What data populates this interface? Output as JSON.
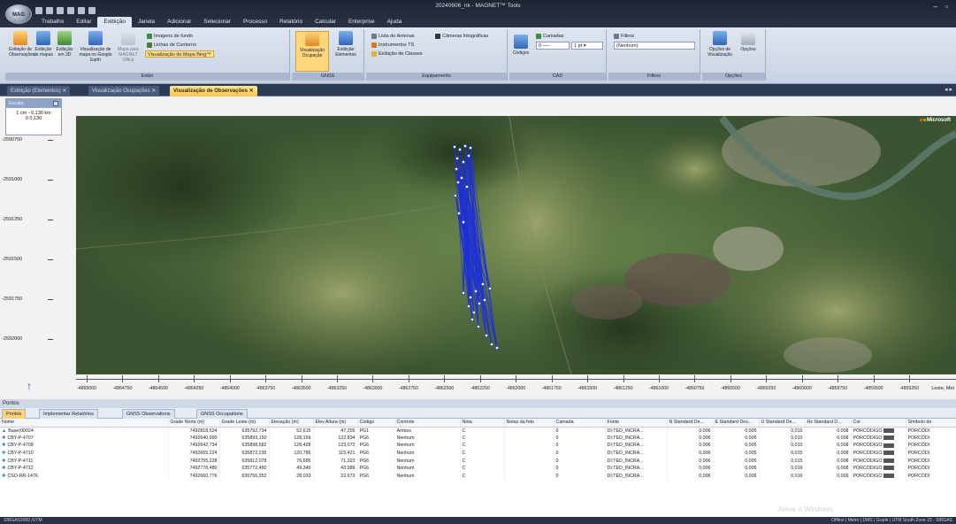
{
  "window": {
    "title": "20240606_nk - MAGNET™ Tools",
    "orb_label": "MAG"
  },
  "menu_tabs": [
    "Trabalho",
    "Editar",
    "Exibição",
    "Janela",
    "Adicionar",
    "Selecionar",
    "Processo",
    "Relatório",
    "Calcular",
    "Enterprise",
    "Ajuda"
  ],
  "active_menu_tab": "Exibição",
  "ribbon": {
    "buttons": [
      "Exibição de Observações",
      "Exibição de mapas",
      "Exibição em 3D",
      "Visualização de mapa no Google Earth",
      "Mapa para MAGNET Office"
    ],
    "small_items": [
      "Imagens de fundo",
      "Linhas de Contorno",
      "Visualização do Mapa Bing™",
      "Lista de Antenas",
      "Câmeras fotográficas",
      "Instrumentos TS",
      "Exibição de Classes"
    ],
    "gnss_buttons": [
      "Visualização Ocupação",
      "Exibição Elementos"
    ],
    "group_labels": [
      "Exibir",
      "GNSS",
      "Equipamento",
      "CAD",
      "Filtros",
      "Opções"
    ],
    "cad": {
      "camadas_label": "Camadas",
      "layer_value": "0",
      "line_value": "1 pt"
    },
    "codigos_label": "Códigos",
    "filtros": {
      "label": "Filtros",
      "value": "(Nenhum)"
    },
    "opcoes_buttons": [
      "Opções de Visualização",
      "Opções"
    ]
  },
  "doc_tabs": [
    {
      "label": "Exibição (Elementos)",
      "active": false
    },
    {
      "label": "Visualização Ocupações",
      "active": false
    },
    {
      "label": "Visualização de Observações",
      "active": true
    }
  ],
  "map": {
    "legend_title": "Escala",
    "scale_text": "1 cm - 0,130 km",
    "scale_values": "0    0,130",
    "provider_label": "Microsoft",
    "y_ticks": [
      "-2590750",
      "-2591000",
      "-2591250",
      "-2591500",
      "-2591750",
      "-2592000"
    ],
    "x_ticks": [
      "-4865000",
      "-4864750",
      "-4864500",
      "-4864250",
      "-4864000",
      "-4863750",
      "-4863500",
      "-4863250",
      "-4863000",
      "-4862750",
      "-4862500",
      "-4862250",
      "-4862000",
      "-4861750",
      "-4861500",
      "-4861250",
      "-4861000",
      "-4860750",
      "-4860500",
      "-4860250",
      "-4860000",
      "-4859750",
      "-4859500",
      "-4859250"
    ],
    "x_axis_label": "Leste, Met"
  },
  "panel": {
    "title": "Pontos",
    "tabs": [
      {
        "label": "Pontos",
        "active": true
      },
      {
        "label": "Implementar Relatórios",
        "active": false
      },
      {
        "label": "GNSS Observations",
        "active": false
      },
      {
        "label": "GNSS Occupations",
        "active": false
      }
    ],
    "columns": [
      "Nome",
      "Grade Norte (m)",
      "Grade Leste (m)",
      "Elevação (m)",
      "Elev.Altura (m)",
      "Código",
      "Controle",
      "Nota",
      "Notas da foto",
      "Camada",
      "Fonte",
      "N Standard De...",
      "E Standard Dev...",
      "U Standard De...",
      "Hz Standard D...",
      "Cor",
      "Símbolo de"
    ],
    "rows": [
      [
        "Base(00024",
        "7492818,524",
        "635792,734",
        "52,615",
        "47,255",
        "PG1",
        "Ambos",
        "C",
        "",
        "0",
        "DI;TED_INCRA...",
        "0,006",
        "0,005",
        "0,015",
        "0,008",
        "PORCÓDIGO",
        "PORCÓDI"
      ],
      [
        "CBY-P-4707",
        "7492640,990",
        "635893,150",
        "128,159",
        "122,834",
        "PG6",
        "Nenhum",
        "C",
        "",
        "0",
        "DI;TED_INCRA...",
        "0,006",
        "0,005",
        "0,015",
        "0,008",
        "PORCÓDIGO",
        "PORCÓDI"
      ],
      [
        "CBY-P-4708",
        "7492642,734",
        "635898,582",
        "128,428",
        "123,072",
        "PG6",
        "Nenhum",
        "C",
        "",
        "0",
        "DI;TED_INCRA...",
        "0,006",
        "0,005",
        "0,015",
        "0,008",
        "PORCÓDIGO",
        "PORCÓDI"
      ],
      [
        "CBY-P-4710",
        "7492665,224",
        "635872,235",
        "120,786",
        "115,421",
        "PG6",
        "Nenhum",
        "C",
        "",
        "0",
        "DI;TED_INCRA...",
        "0,006",
        "0,005",
        "0,015",
        "0,008",
        "PORCÓDIGO",
        "PORCÓDI"
      ],
      [
        "CBY-P-4711",
        "7492755,228",
        "635812,078",
        "76,685",
        "71,323",
        "PG6",
        "Nenhum",
        "C",
        "",
        "0",
        "DI;TED_INCRA...",
        "0,006",
        "0,005",
        "0,015",
        "0,008",
        "PORCÓDIGO",
        "PORCÓDI"
      ],
      [
        "CBY-P-4712",
        "7492778,480",
        "635772,450",
        "49,349",
        "43,989",
        "PG6",
        "Nenhum",
        "C",
        "",
        "0",
        "DI;TED_INCRA...",
        "0,006",
        "0,005",
        "0,016",
        "0,008",
        "PORCÓDIGO",
        "PORCÓDI"
      ],
      [
        "CSO-RR-1476",
        "7492660,776",
        "635755,352",
        "28,033",
        "22,673",
        "PG6",
        "Nenhum",
        "C",
        "",
        "0",
        "DI;TED_INCRA...",
        "0,006",
        "0,006",
        "0,016",
        "0,009",
        "PORCÓDIGO",
        "PORCÓDI"
      ]
    ]
  },
  "status": {
    "left": "SIRGAS2000 /UTM",
    "right": "Offline | Metro | DMS | Grade | UTM South Zone 23 - SIRGAS"
  },
  "watermark": "Ativar o Windows",
  "colors": {
    "ribbon_active": "#f6c54f",
    "point_color": "#1d2fd8",
    "titlebar": "#1d2433"
  }
}
